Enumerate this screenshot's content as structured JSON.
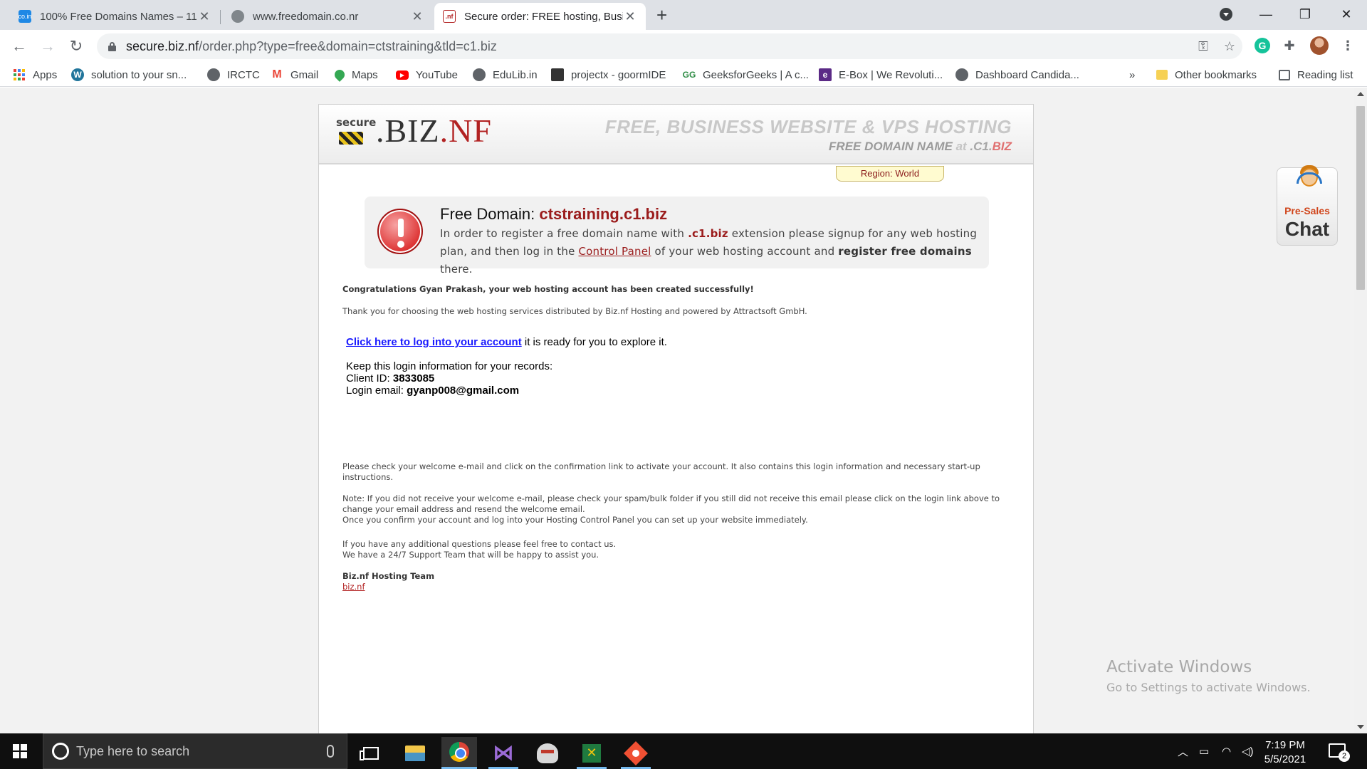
{
  "browser": {
    "tabs": [
      {
        "title": "100% Free Domains Names – 11",
        "favicon": "co-in-favicon",
        "active": false
      },
      {
        "title": "www.freedomain.co.nr",
        "favicon": "globe-icon",
        "active": false
      },
      {
        "title": "Secure order: FREE hosting, Busin",
        "favicon": "nf-favicon",
        "active": true
      }
    ],
    "address": {
      "host": "secure.biz.nf",
      "path": "/order.php?type=free&domain=ctstraining&tld=c1.biz"
    },
    "bookmarks": [
      {
        "label": "Apps",
        "icon": "apps-grid-icon"
      },
      {
        "label": "solution to your sn...",
        "icon": "wordpress-icon"
      },
      {
        "label": "IRCTC",
        "icon": "globe-icon"
      },
      {
        "label": "Gmail",
        "icon": "gmail-icon"
      },
      {
        "label": "Maps",
        "icon": "maps-icon"
      },
      {
        "label": "YouTube",
        "icon": "youtube-icon"
      },
      {
        "label": "EduLib.in",
        "icon": "globe-icon"
      },
      {
        "label": "projectx - goormIDE",
        "icon": "goorm-icon"
      },
      {
        "label": "GeeksforGeeks | A c...",
        "icon": "gfg-icon"
      },
      {
        "label": "E-Box | We Revoluti...",
        "icon": "ebox-icon"
      },
      {
        "label": "Dashboard Candida...",
        "icon": "globe-icon"
      }
    ],
    "bookmarks_overflow": "»",
    "other_bookmarks": "Other bookmarks",
    "reading_list": "Reading list"
  },
  "site": {
    "logo_secure": "secure",
    "logo_brand": ".BIZ",
    "logo_brand_nf": ".NF",
    "tagline_1": "FREE, BUSINESS WEBSITE & VPS HOSTING",
    "tagline_2a": "FREE DOMAIN NAME",
    "tagline_2b": "at",
    "tagline_2c": ".C1.",
    "tagline_2d": "BIZ",
    "region": "Region: World"
  },
  "alert": {
    "title_prefix": "Free Domain:",
    "domain": "ctstraining.c1.biz",
    "text_1": "In order to register a free domain name with",
    "ext": ".c1.biz",
    "text_2": "extension please signup for any web hosting plan, and then log in the",
    "link": "Control Panel",
    "text_3": "of your web hosting account and",
    "bold": "register free domains",
    "text_4": "there."
  },
  "content": {
    "congrats": "Congratulations Gyan Prakash, your web hosting account has been created successfully!",
    "thanks": "Thank you for choosing the web hosting services distributed by Biz.nf Hosting and powered by Attractsoft GmbH.",
    "login_link": "Click here to log into your account",
    "login_rest": "it is ready for you to explore it.",
    "keep_info": "Keep this login information for your records:",
    "client_label": "Client ID:",
    "client_id": "3833085",
    "email_label": "Login email:",
    "email": "gyanp008@gmail.com",
    "welcome": "Please check your welcome e-mail and click on the confirmation link to activate your account. It also contains this login information and necessary start-up instructions.",
    "note_1": "Note: If you did not receive your welcome e-mail, please check your spam/bulk folder if you still did not receive this email please click on the login link above to change your email address and resend the welcome email.",
    "note_2": "Once you confirm your account and log into your Hosting Control Panel you can set up your website immediately.",
    "questions_1": "If you have any additional questions please feel free to contact us.",
    "questions_2": "We have a 24/7 Support Team that will be happy to assist you.",
    "team": "Biz.nf Hosting Team",
    "team_link": "biz.nf"
  },
  "chat": {
    "pre": "Pre-Sales",
    "chat": "Chat"
  },
  "watermark": {
    "line1": "Activate Windows",
    "line2": "Go to Settings to activate Windows."
  },
  "taskbar": {
    "search_placeholder": "Type here to search",
    "time": "7:19 PM",
    "date": "5/5/2021",
    "notifications": "2"
  }
}
